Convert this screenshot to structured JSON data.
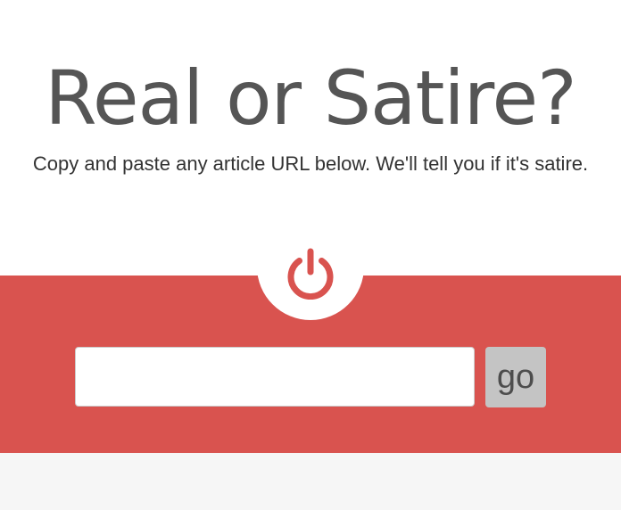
{
  "header": {
    "title": "Real or Satire?",
    "subtitle": "Copy and paste any article URL below. We'll tell you if it's satire."
  },
  "form": {
    "url_input_value": "",
    "url_input_placeholder": "",
    "submit_label": "go"
  },
  "icons": {
    "center": "power-icon"
  },
  "colors": {
    "accent": "#d9534f",
    "title_text": "#555555",
    "button_bg": "#c4c4c4",
    "footer_bg": "#f6f6f6"
  }
}
